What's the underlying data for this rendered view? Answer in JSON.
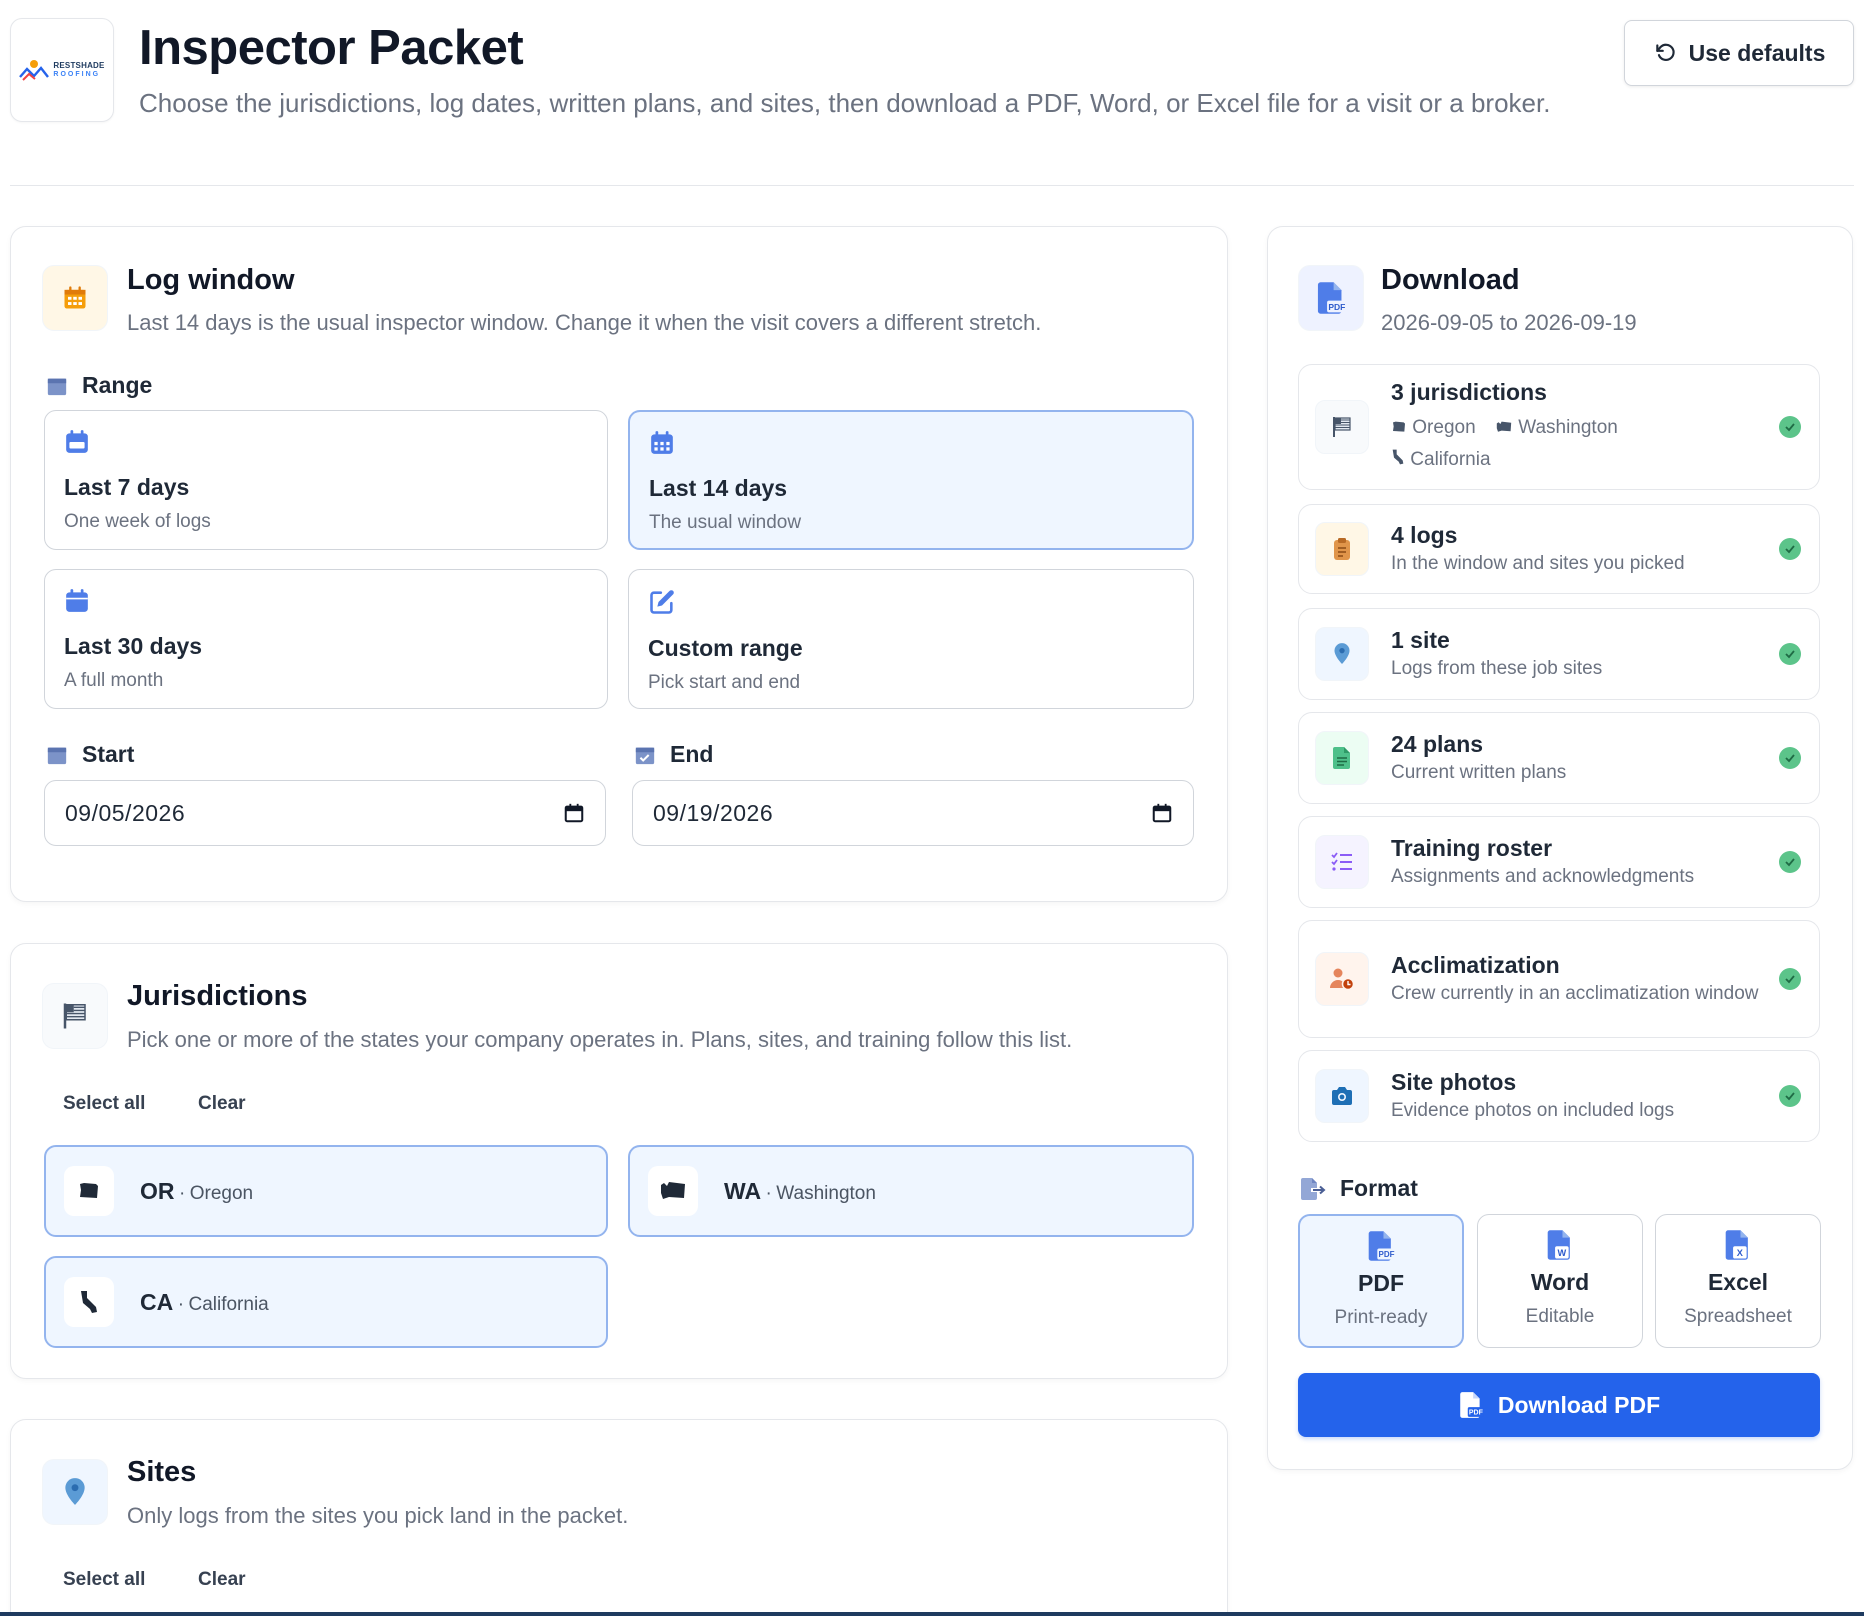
{
  "header": {
    "title": "Inspector Packet",
    "subtitle": "Choose the jurisdictions, log dates, written plans, and sites, then download a PDF, Word, or Excel file for a visit or a broker.",
    "defaults_label": "Use defaults",
    "logo_text": "RESTSHADE",
    "logo_sub": "ROOFING"
  },
  "log_window": {
    "title": "Log window",
    "description": "Last 14 days is the usual inspector window. Change it when the visit covers a different stretch.",
    "range_label": "Range",
    "options": [
      {
        "title": "Last 7 days",
        "subtitle": "One week of logs"
      },
      {
        "title": "Last 14 days",
        "subtitle": "The usual window"
      },
      {
        "title": "Last 30 days",
        "subtitle": "A full month"
      },
      {
        "title": "Custom range",
        "subtitle": "Pick start and end"
      }
    ],
    "selected_option": "Last 14 days",
    "start_label": "Start",
    "start_value": "09/05/2026",
    "end_label": "End",
    "end_value": "09/19/2026"
  },
  "jurisdictions": {
    "title": "Jurisdictions",
    "description": "Pick one or more of the states your company operates in. Plans, sites, and training follow this list.",
    "select_all": "Select all",
    "clear": "Clear",
    "items": [
      {
        "abbr": "OR",
        "sep": "·",
        "name": "Oregon"
      },
      {
        "abbr": "WA",
        "sep": "·",
        "name": "Washington"
      },
      {
        "abbr": "CA",
        "sep": "·",
        "name": "California"
      }
    ]
  },
  "sites": {
    "title": "Sites",
    "description": "Only logs from the sites you pick land in the packet.",
    "select_all": "Select all",
    "clear": "Clear"
  },
  "download": {
    "title": "Download",
    "range_text": "2026-09-05 to 2026-09-19",
    "summary": [
      {
        "title": "3 jurisdictions",
        "tags": [
          "Oregon",
          "Washington",
          "California"
        ],
        "icon": "flag-icon"
      },
      {
        "title": "4 logs",
        "subtitle": "In the window and sites you picked",
        "icon": "clipboard-icon"
      },
      {
        "title": "1 site",
        "subtitle": "Logs from these job sites",
        "icon": "map-pin-icon"
      },
      {
        "title": "24 plans",
        "subtitle": "Current written plans",
        "icon": "document-icon"
      },
      {
        "title": "Training roster",
        "subtitle": "Assignments and acknowledgments",
        "icon": "checklist-icon"
      },
      {
        "title": "Acclimatization",
        "subtitle": "Crew currently in an acclimatization window",
        "icon": "user-clock-icon"
      },
      {
        "title": "Site photos",
        "subtitle": "Evidence photos on included logs",
        "icon": "camera-icon"
      }
    ],
    "format_label": "Format",
    "formats": [
      {
        "title": "PDF",
        "subtitle": "Print-ready",
        "badge": "PDF"
      },
      {
        "title": "Word",
        "subtitle": "Editable",
        "badge": "W"
      },
      {
        "title": "Excel",
        "subtitle": "Spreadsheet",
        "badge": "X"
      }
    ],
    "selected_format": "PDF",
    "button_label": "Download PDF"
  },
  "colors": {
    "accent": "#2463eb",
    "selected_bg": "#eff6ff",
    "selected_border": "#93b4ee",
    "check": "#5cc48a",
    "calendar_orange": "#f59e0b"
  }
}
